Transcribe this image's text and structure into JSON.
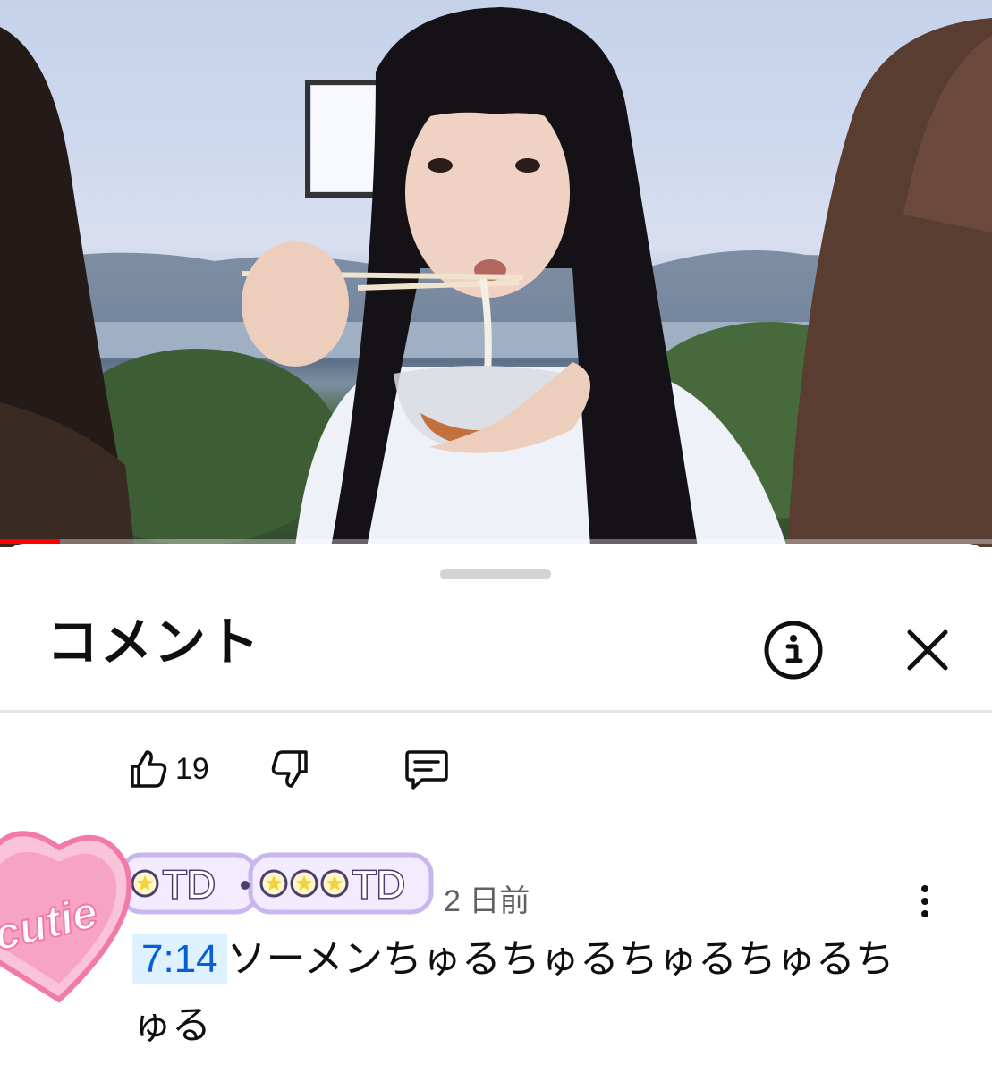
{
  "video": {
    "progress_fraction": 0.06,
    "progress_color": "#ff0000"
  },
  "comments_panel": {
    "title": "コメント",
    "info_icon": "info-icon",
    "close_icon": "close-icon"
  },
  "previous_comment_actions": {
    "like_count": "19",
    "like_icon": "thumb-up-icon",
    "dislike_icon": "thumb-down-icon",
    "reply_icon": "comment-icon"
  },
  "comment": {
    "author_badge_text": "OTD·OOTD",
    "age": "2 日前",
    "timestamp": "7:14",
    "text": "ソーメンちゅるちゅるちゅるちゅるちゅる",
    "more_icon": "more-vertical-icon"
  },
  "sticker": {
    "text": "cutie",
    "color": "#f27aa8"
  },
  "colors": {
    "link_blue": "#065fd4",
    "link_bg": "#def1ff",
    "badge_purple": "#c9b6f0"
  }
}
